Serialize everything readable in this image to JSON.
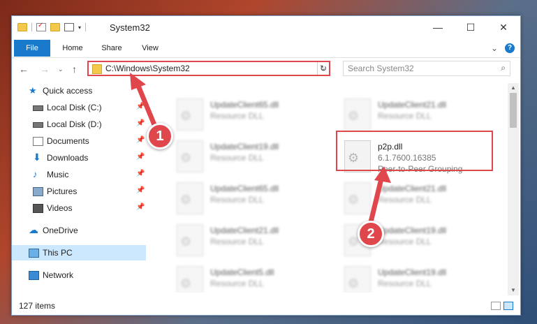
{
  "window": {
    "title": "System32",
    "controls": {
      "minimize": "—",
      "maximize": "☐",
      "close": "✕"
    }
  },
  "ribbon": {
    "tabs": [
      "File",
      "Home",
      "Share",
      "View"
    ],
    "expand": "⌄",
    "help": "?"
  },
  "address": {
    "path": "C:\\Windows\\System32",
    "dropdown": "⌄",
    "refresh": "↻"
  },
  "search": {
    "placeholder": "Search System32",
    "icon": "⌕"
  },
  "nav_buttons": {
    "back": "←",
    "forward": "→",
    "recent": "⌄",
    "up": "↑"
  },
  "sidebar": {
    "items": [
      {
        "label": "Quick access",
        "icon": "star-icon",
        "pinned": false
      },
      {
        "label": "Local Disk (C:)",
        "icon": "drive-icon",
        "pinned": true
      },
      {
        "label": "Local Disk (D:)",
        "icon": "drive-icon",
        "pinned": true
      },
      {
        "label": "Documents",
        "icon": "documents-icon",
        "pinned": true
      },
      {
        "label": "Downloads",
        "icon": "download-icon",
        "pinned": true
      },
      {
        "label": "Music",
        "icon": "music-icon",
        "pinned": true
      },
      {
        "label": "Pictures",
        "icon": "pictures-icon",
        "pinned": true
      },
      {
        "label": "Videos",
        "icon": "videos-icon",
        "pinned": true
      },
      {
        "label": "OneDrive",
        "icon": "cloud-icon",
        "pinned": false
      },
      {
        "label": "This PC",
        "icon": "computer-icon",
        "pinned": false,
        "selected": true
      },
      {
        "label": "Network",
        "icon": "network-icon",
        "pinned": false
      }
    ],
    "pin_glyph": "📌"
  },
  "files": [
    {
      "name": "UpdateClient65.dll",
      "desc": "Resource DLL"
    },
    {
      "name": "UpdateClient21.dll",
      "desc": "Resource DLL"
    },
    {
      "name": "UpdateClient19.dll",
      "desc": "Resource DLL"
    },
    {
      "name": "p2p.dll",
      "desc": "6.1.7600.16385",
      "desc2": "Peer-to-Peer Grouping",
      "highlighted": true
    },
    {
      "name": "UpdateClient65.dll",
      "desc": "Resource DLL"
    },
    {
      "name": "UpdateClient21.dll",
      "desc": "Resource DLL"
    },
    {
      "name": "UpdateClient21.dll",
      "desc": "Resource DLL"
    },
    {
      "name": "UpdateClient19.dll",
      "desc": "Resource DLL"
    },
    {
      "name": "UpdateClient5.dll",
      "desc": "Resource DLL"
    },
    {
      "name": "UpdateClient19.dll",
      "desc": "Resource DLL"
    }
  ],
  "status": {
    "item_count": "127 items"
  },
  "annotations": [
    {
      "number": "1"
    },
    {
      "number": "2"
    }
  ],
  "colors": {
    "accent": "#1979ca",
    "highlight": "#e0474c",
    "selected": "#cce8ff"
  }
}
